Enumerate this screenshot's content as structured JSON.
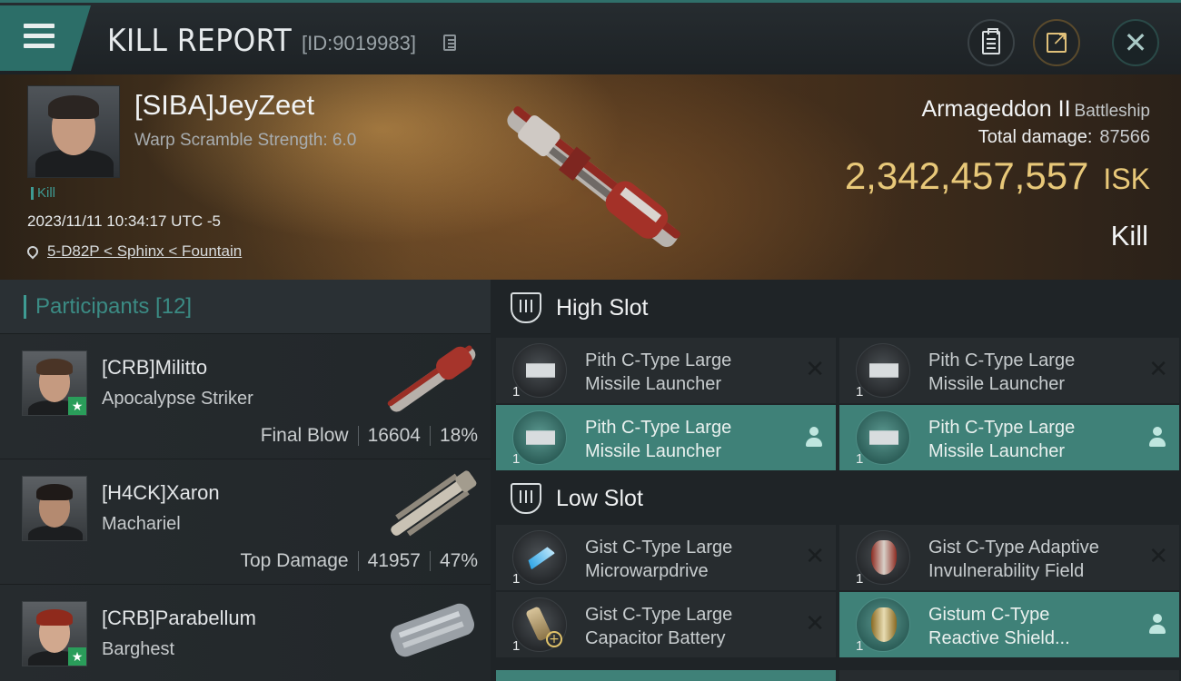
{
  "header": {
    "title": "KILL REPORT",
    "report_id": "[ID:9019983]",
    "icons": [
      "menu-icon",
      "copy-icon",
      "clipboard-icon",
      "share-icon",
      "close-icon"
    ]
  },
  "victim": {
    "name": "[SIBA]JeyZeet",
    "warp_scramble": "Warp Scramble Strength: 6.0",
    "tag": "Kill",
    "timestamp": "2023/11/11 10:34:17 UTC -5",
    "location": "5-D82P < Sphinx < Fountain",
    "ship_name": "Armageddon II",
    "ship_class": "Battleship",
    "total_damage_label": "Total damage:",
    "total_damage": "87566",
    "isk_value": "2,342,457,557",
    "isk_unit": "ISK",
    "result": "Kill"
  },
  "participants": {
    "title": "Participants [12]",
    "rows": [
      {
        "name": "[CRB]Militto",
        "ship": "Apocalypse Striker",
        "role": "Final Blow",
        "damage": "16604",
        "percent": "18%",
        "starred": true
      },
      {
        "name": "[H4CK]Xaron",
        "ship": "Machariel",
        "role": "Top Damage",
        "damage": "41957",
        "percent": "47%",
        "starred": false
      },
      {
        "name": "[CRB]Parabellum",
        "ship": "Barghest",
        "role": "",
        "damage": "",
        "percent": "",
        "starred": true
      }
    ]
  },
  "fitting": {
    "high_slot_label": "High Slot",
    "low_slot_label": "Low Slot",
    "high": [
      {
        "line1": "Pith C-Type Large",
        "line2": "Missile Launcher",
        "qty": "1",
        "state": "destroyed"
      },
      {
        "line1": "Pith C-Type Large",
        "line2": "Missile Launcher",
        "qty": "1",
        "state": "destroyed"
      },
      {
        "line1": "Pith C-Type Large",
        "line2": "Missile Launcher",
        "qty": "1",
        "state": "dropped"
      },
      {
        "line1": "Pith C-Type Large",
        "line2": "Missile Launcher",
        "qty": "1",
        "state": "dropped"
      }
    ],
    "low": [
      {
        "line1": "Gist C-Type Large",
        "line2": "Microwarpdrive",
        "qty": "1",
        "state": "destroyed"
      },
      {
        "line1": "Gist C-Type Adaptive",
        "line2": "Invulnerability Field",
        "qty": "1",
        "state": "destroyed"
      },
      {
        "line1": "Gist C-Type Large",
        "line2": "Capacitor Battery",
        "qty": "1",
        "state": "destroyed"
      },
      {
        "line1": "Gistum C-Type",
        "line2": "Reactive Shield...",
        "qty": "1",
        "state": "dropped"
      }
    ]
  },
  "colors": {
    "accent": "#3e9b93",
    "isk_gold": "#e8c879",
    "dropped_row": "#3f8178",
    "star_badge": "#2a9d5a"
  }
}
